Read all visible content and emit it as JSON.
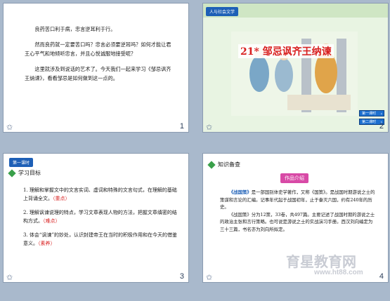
{
  "slide1": {
    "para1": "良药苦口利于病，忠言逆耳利于行。",
    "para2": "然而良药就一定要苦口吗？忠言必须要逆耳吗？如何才能让君王心平气和地倾听忠言，并且心悦诚服地接受呢？",
    "para3": "这里就涉及到说话的艺术了。今天我们一起来学习《邹忌讽齐王纳谏》，看看邹忌是如何做到这一点的。",
    "page": "1"
  },
  "slide2": {
    "badge": "人与社会文学",
    "title": "21*  邹忌讽齐王纳谏",
    "btn1": "第一课时",
    "btn2": "第二课时",
    "page": "2"
  },
  "slide3": {
    "badge": "第一课时",
    "heading": "学习目标",
    "item1": "1. 理解和掌握文中的文言实词、虚词和特殊的文言句式，在理解的基础上背诵全文。",
    "tag1": "（重点）",
    "item2": "2. 理解讽谏说理的特点，学习文章表现人物的方法，把握文章缜密的结构方式。",
    "tag2": "（难点）",
    "item3": "3. 体会“讽谏”的妙处，认识封建帝王在当时的积极作用和在今天的借鉴意义。",
    "tag3": "（素养）",
    "page": "3"
  },
  "slide4": {
    "heading": "知识备查",
    "label": "作品介绍",
    "book": "《战国策》",
    "text1": "是一部国别体史学著作，又称《国策》。是战国时期游说之士的策谋和言论的汇编。记事年代起于战国初年，止于秦灭六国，约有240年的历史。",
    "text2": "《战国策》分为12策，33卷，共497篇。主要记述了战国时期的游说之士的政治主张和言行策略。也可说是游说之士的实战演习手册。西汉刘向编定为三十三篇，书名亦为刘向所拟定。",
    "page": "4"
  },
  "watermark": {
    "brand": "育星教育网",
    "url": "www.ht88.com"
  }
}
